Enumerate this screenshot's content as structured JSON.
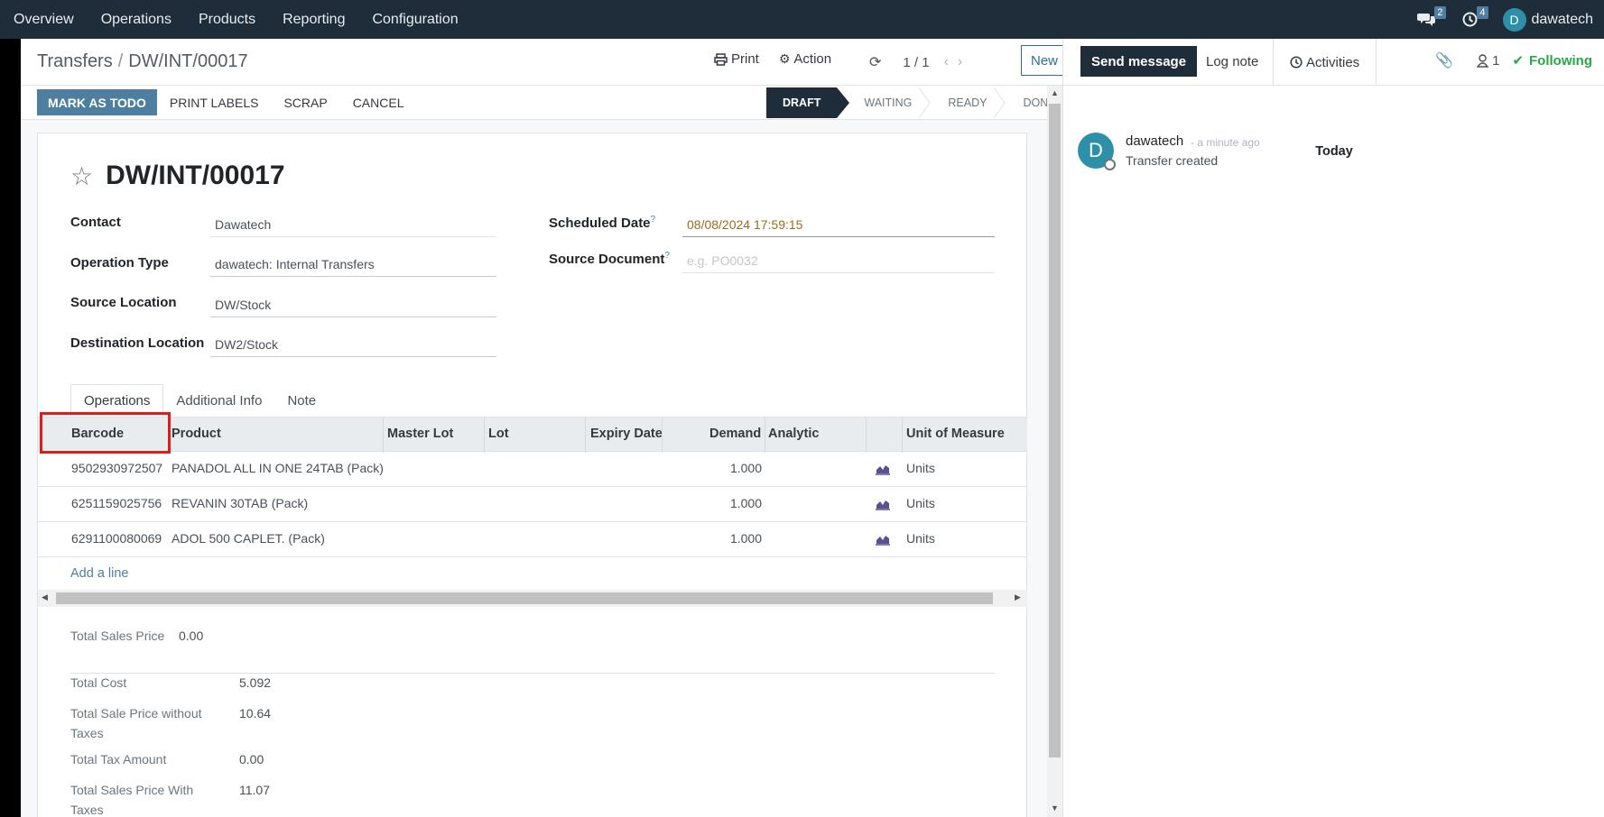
{
  "topnav": {
    "menu": [
      "Overview",
      "Operations",
      "Products",
      "Reporting",
      "Configuration"
    ],
    "messages_count": "2",
    "activities_count": "4",
    "user_initial": "D",
    "user_name": "dawatech"
  },
  "control": {
    "breadcrumb_parent": "Transfers",
    "breadcrumb_sep": "/",
    "breadcrumb_current": "DW/INT/00017",
    "print_label": "Print",
    "action_label": "Action",
    "pager": "1 / 1",
    "new_label": "New"
  },
  "statusbar": {
    "buttons": [
      "MARK AS TODO",
      "PRINT LABELS",
      "SCRAP",
      "CANCEL"
    ],
    "stages": [
      "DRAFT",
      "WAITING",
      "READY",
      "DONE"
    ],
    "active_stage": "DRAFT"
  },
  "form": {
    "title": "DW/INT/00017",
    "contact_label": "Contact",
    "contact": "Dawatech",
    "operation_type_label": "Operation Type",
    "operation_type": "dawatech: Internal Transfers",
    "source_location_label": "Source Location",
    "source_location": "DW/Stock",
    "destination_location_label": "Destination Location",
    "destination_location": "DW2/Stock",
    "scheduled_date_label": "Scheduled Date",
    "scheduled_date": "08/08/2024 17:59:15",
    "source_document_label": "Source Document",
    "source_document_placeholder": "e.g. PO0032",
    "help_mark": "?"
  },
  "tabs": [
    "Operations",
    "Additional Info",
    "Note"
  ],
  "table": {
    "columns": [
      "Barcode",
      "Product",
      "Master Lot",
      "Lot",
      "Expiry Date",
      "Demand",
      "Analytic",
      "Unit of Measure"
    ],
    "rows": [
      {
        "barcode": "9502930972507",
        "product": "PANADOL ALL IN ONE 24TAB (Pack)",
        "demand": "1.000",
        "uom": "Units"
      },
      {
        "barcode": "6251159025756",
        "product": "REVANIN 30TAB (Pack)",
        "demand": "1.000",
        "uom": "Units"
      },
      {
        "barcode": "6291100080069",
        "product": "ADOL 500 CAPLET. (Pack)",
        "demand": "1.000",
        "uom": "Units"
      }
    ],
    "add_line": "Add a line"
  },
  "totals": {
    "total_sales_price_label": "Total Sales Price",
    "total_sales_price": "0.00",
    "total_cost_label": "Total Cost",
    "total_cost": "5.092",
    "total_sale_no_tax_label": "Total Sale Price without Taxes",
    "total_sale_no_tax": "10.64",
    "total_tax_label": "Total Tax Amount",
    "total_tax": "0.00",
    "total_with_tax_label": "Total Sales Price With Taxes",
    "total_with_tax": "11.07"
  },
  "chatter": {
    "send_message": "Send message",
    "log_note": "Log note",
    "activities": "Activities",
    "followers_count": "1",
    "following": "Following",
    "today": "Today",
    "message": {
      "avatar_initial": "D",
      "author": "dawatech",
      "time": "- a minute ago",
      "body": "Transfer created"
    }
  },
  "colors": {
    "navbar": "#1f2d3a",
    "primary": "#4f7fa0",
    "following": "#28a745",
    "highlight": "#dd1c1c"
  }
}
